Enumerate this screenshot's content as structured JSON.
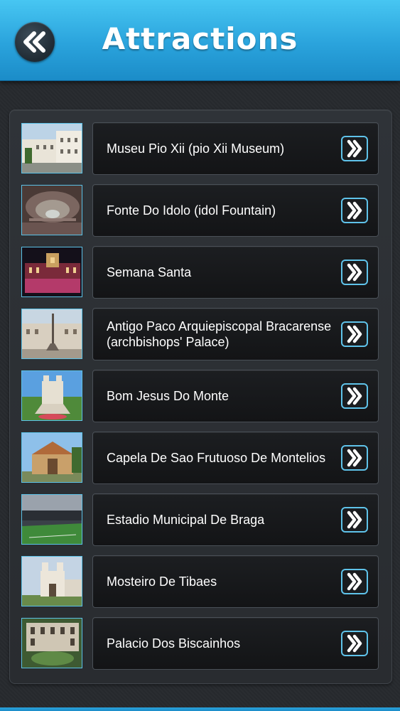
{
  "header": {
    "title": "Attractions",
    "back_icon": "double-chevron-left-icon",
    "accent_color": "#2aa3dc"
  },
  "list": {
    "item_icon": "double-chevron-right-icon",
    "items": [
      {
        "label": "Museu Pio Xii (pio Xii Museum)",
        "thumb": "museum-photo"
      },
      {
        "label": "Fonte Do Idolo (idol Fountain)",
        "thumb": "fountain-photo"
      },
      {
        "label": "Semana Santa",
        "thumb": "night-building-photo"
      },
      {
        "label": "Antigo Paco Arquiepiscopal Bracarense (archbishops' Palace)",
        "thumb": "palace-photo"
      },
      {
        "label": "Bom Jesus Do Monte",
        "thumb": "sanctuary-photo"
      },
      {
        "label": "Capela De Sao Frutuoso De Montelios",
        "thumb": "chapel-photo"
      },
      {
        "label": "Estadio Municipal De Braga",
        "thumb": "stadium-photo"
      },
      {
        "label": "Mosteiro De Tibaes",
        "thumb": "monastery-photo"
      },
      {
        "label": "Palacio Dos Biscainhos",
        "thumb": "garden-palace-photo"
      }
    ]
  }
}
